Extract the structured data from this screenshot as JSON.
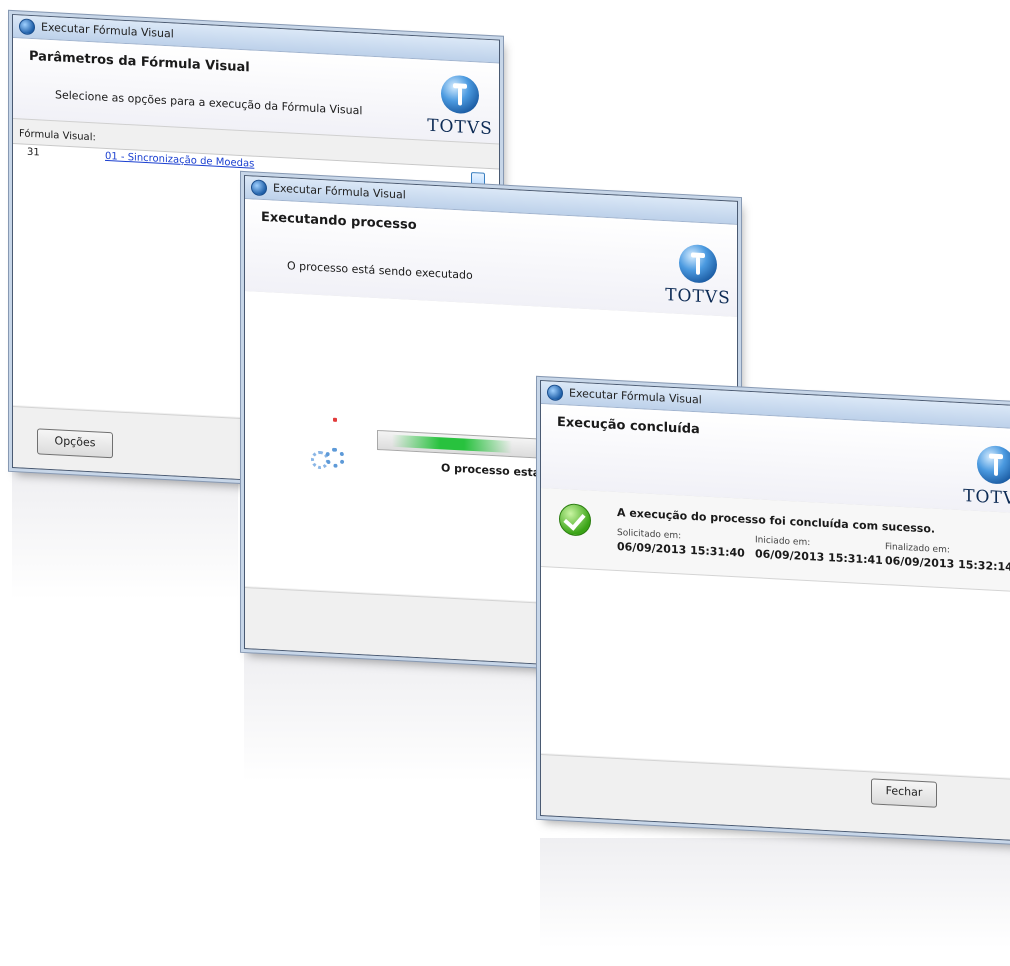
{
  "window_title": "Executar Fórmula Visual",
  "logo_text": "TOTVS",
  "step1": {
    "header_title": "Parâmetros da Fórmula Visual",
    "header_sub": "Selecione as opções para a execução da Fórmula Visual",
    "formula_label": "Fórmula Visual:",
    "formula_code": "31",
    "formula_link": "01 - Sincronização de Moedas",
    "options_button": "Opções"
  },
  "step2": {
    "header_title": "Executando processo",
    "header_sub": "O processo está sendo executado",
    "progress_text": "O processo está"
  },
  "step3": {
    "header_title": "Execução concluída",
    "message": "A execução do processo foi concluída com sucesso.",
    "requested_label": "Solicitado em:",
    "requested_value": "06/09/2013 15:31:40",
    "started_label": "Iniciado em:",
    "started_value": "06/09/2013 15:31:41",
    "finished_label": "Finalizado em:",
    "finished_value": "06/09/2013 15:32:14",
    "close_button": "Fechar"
  }
}
